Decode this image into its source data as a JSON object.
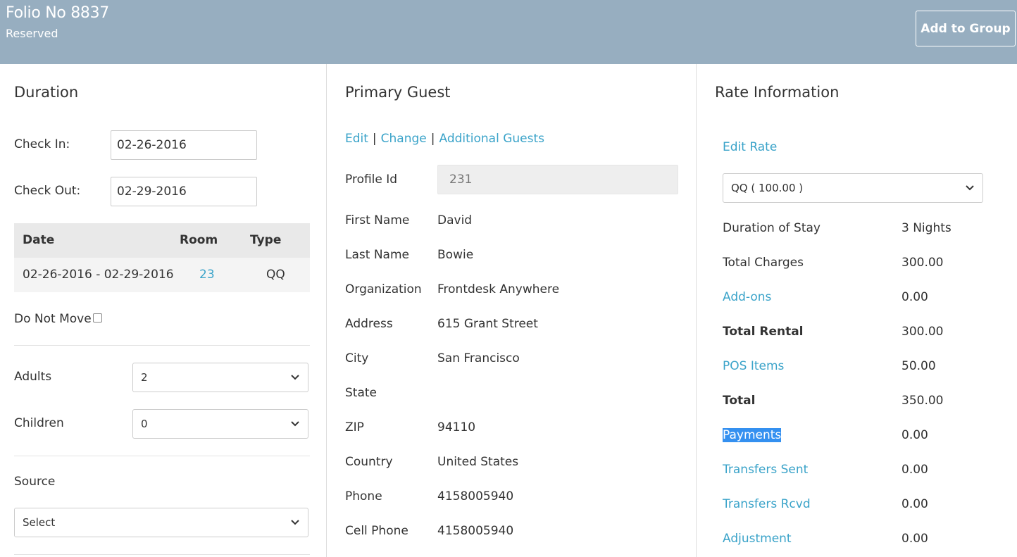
{
  "header": {
    "folio_title": "Folio No 8837",
    "status": "Reserved",
    "add_to_group_label": "Add to Group"
  },
  "duration": {
    "title": "Duration",
    "check_in_label": "Check In:",
    "check_in_value": "02-26-2016",
    "check_out_label": "Check Out:",
    "check_out_value": "02-29-2016",
    "table": {
      "headers": {
        "date": "Date",
        "room": "Room",
        "type": "Type"
      },
      "row": {
        "date": "02-26-2016 - 02-29-2016",
        "room": "23",
        "type": "QQ"
      }
    },
    "do_not_move_label": "Do Not Move",
    "adults_label": "Adults",
    "adults_value": "2",
    "children_label": "Children",
    "children_value": "0",
    "source_label": "Source",
    "source_value": "Select"
  },
  "guest": {
    "title": "Primary Guest",
    "links": {
      "edit": "Edit",
      "change": "Change",
      "additional": "Additional Guests",
      "separator": "|"
    },
    "profile_id_label": "Profile Id",
    "profile_id_value": "231",
    "fields": [
      {
        "label": "First Name",
        "value": "David"
      },
      {
        "label": "Last Name",
        "value": "Bowie"
      },
      {
        "label": "Organization",
        "value": "Frontdesk Anywhere"
      },
      {
        "label": "Address",
        "value": "615 Grant Street"
      },
      {
        "label": "City",
        "value": "San Francisco"
      },
      {
        "label": "State",
        "value": ""
      },
      {
        "label": "ZIP",
        "value": "94110"
      },
      {
        "label": "Country",
        "value": "United States"
      },
      {
        "label": "Phone",
        "value": "4158005940"
      },
      {
        "label": "Cell Phone",
        "value": "4158005940"
      }
    ]
  },
  "rate": {
    "title": "Rate Information",
    "edit_rate_label": "Edit Rate",
    "rate_select_value": "QQ ( 100.00 )",
    "rows": [
      {
        "label": "Duration of Stay",
        "value": "3 Nights"
      },
      {
        "label": "Total Charges",
        "value": "300.00"
      },
      {
        "label": "Add-ons",
        "value": "0.00"
      },
      {
        "label": "Total Rental",
        "value": "300.00"
      },
      {
        "label": "POS Items",
        "value": "50.00"
      },
      {
        "label": "Total",
        "value": "350.00"
      },
      {
        "label": "Payments",
        "value": "0.00"
      },
      {
        "label": "Transfers Sent",
        "value": "0.00"
      },
      {
        "label": "Transfers Rcvd",
        "value": "0.00"
      },
      {
        "label": "Adjustment",
        "value": "0.00"
      }
    ]
  },
  "colors": {
    "header_bg": "#97aec0",
    "link": "#3aa3c9",
    "selection": "#3490f0"
  },
  "icons": [
    "chevron-down-icon"
  ]
}
